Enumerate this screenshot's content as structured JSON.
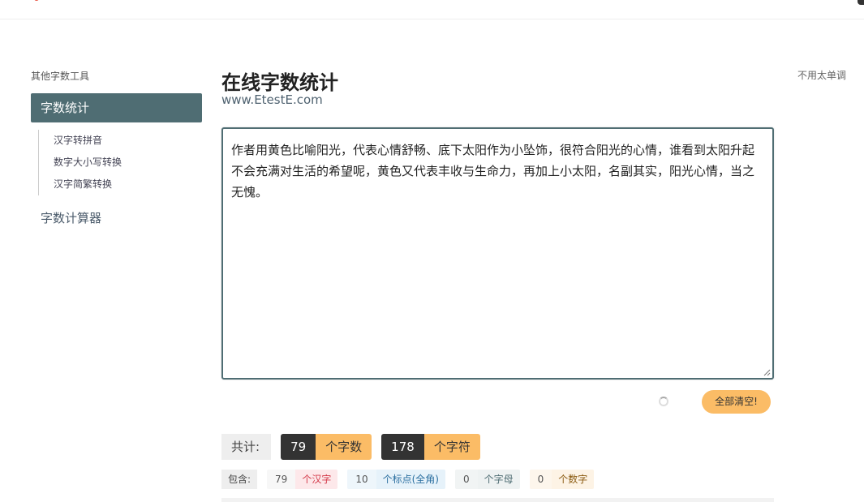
{
  "sidebar": {
    "title": "其他字数工具",
    "active_item": "字数统计",
    "sub_items": [
      "汉字转拼音",
      "数字大小写转换",
      "汉字简繁转换"
    ],
    "item2": "字数计算器"
  },
  "header": {
    "title": "在线字数统计",
    "subtitle": "www.EtestE.com",
    "right_note": "不用太单调"
  },
  "editor": {
    "text": "作者用黄色比喻阳光，代表心情舒畅、底下太阳作为小坠饰，很符合阳光的心情，谁看到太阳升起不会充满对生活的希望呢，黄色又代表丰收与生命力，再加上小太阳，名副其实，阳光心情，当之无愧。"
  },
  "actions": {
    "clear_label": "全部清空!"
  },
  "totals": {
    "label": "共计:",
    "words_value": "79",
    "words_unit": "个字数",
    "chars_value": "178",
    "chars_unit": "个字符"
  },
  "details": {
    "label": "包含:",
    "items": [
      {
        "value": "79",
        "unit": "个汉字"
      },
      {
        "value": "10",
        "unit": "个标点(全角)"
      },
      {
        "value": "0",
        "unit": "个字母"
      },
      {
        "value": "0",
        "unit": "个数字"
      }
    ]
  },
  "colors": {
    "accent": "#4f6d73",
    "highlight": "#fbbc66"
  }
}
